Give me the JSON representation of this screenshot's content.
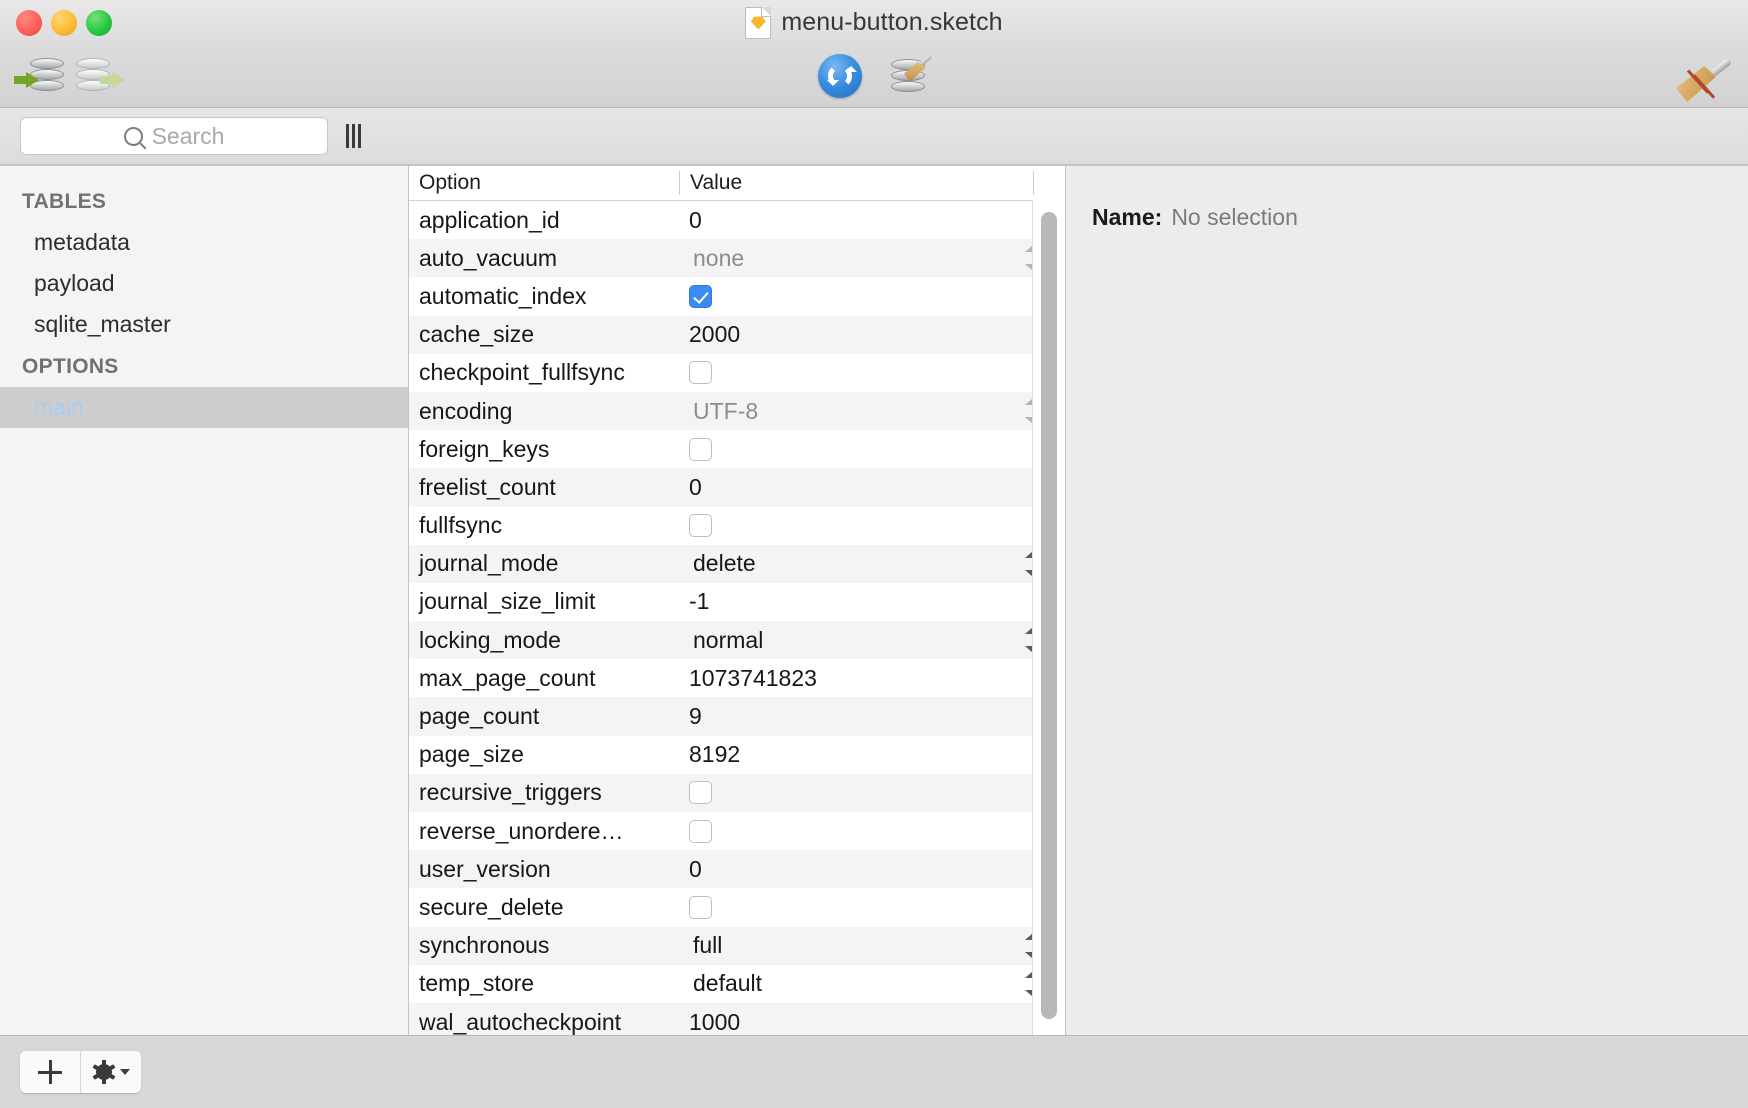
{
  "window": {
    "title": "menu-button.sketch",
    "doc_icon": "sketch-document-icon",
    "traffic_lights": [
      "close",
      "minimize",
      "zoom"
    ]
  },
  "toolbar": {
    "import_label": "import-database-icon",
    "export_label": "export-database-icon",
    "refresh_label": "refresh-icon",
    "vacuum_label": "vacuum-database-icon",
    "broom_label": "broom-icon"
  },
  "search": {
    "placeholder": "Search",
    "value": "",
    "icon": "search-icon",
    "grip": "sidebar-resize-grip"
  },
  "sidebar": {
    "sections": [
      {
        "header": "TABLES",
        "items": [
          {
            "label": "metadata",
            "selected": false
          },
          {
            "label": "payload",
            "selected": false
          },
          {
            "label": "sqlite_master",
            "selected": false
          }
        ]
      },
      {
        "header": "OPTIONS",
        "items": [
          {
            "label": "main",
            "selected": true
          }
        ]
      }
    ],
    "selection_bg": "#cdcdcd",
    "selection_fg": "#a9cdf0"
  },
  "table": {
    "columns": [
      "Option",
      "Value"
    ],
    "rows": [
      {
        "option": "application_id",
        "kind": "text",
        "value": "0"
      },
      {
        "option": "auto_vacuum",
        "kind": "popup",
        "value": "none",
        "dim": true
      },
      {
        "option": "automatic_index",
        "kind": "checkbox",
        "value": true
      },
      {
        "option": "cache_size",
        "kind": "text",
        "value": "2000"
      },
      {
        "option": "checkpoint_fullfsync",
        "kind": "checkbox",
        "value": false
      },
      {
        "option": "encoding",
        "kind": "popup",
        "value": "UTF-8",
        "dim": true
      },
      {
        "option": "foreign_keys",
        "kind": "checkbox",
        "value": false
      },
      {
        "option": "freelist_count",
        "kind": "text",
        "value": "0"
      },
      {
        "option": "fullfsync",
        "kind": "checkbox",
        "value": false
      },
      {
        "option": "journal_mode",
        "kind": "popup",
        "value": "delete",
        "dim": false
      },
      {
        "option": "journal_size_limit",
        "kind": "text",
        "value": "-1"
      },
      {
        "option": "locking_mode",
        "kind": "popup",
        "value": "normal",
        "dim": false
      },
      {
        "option": "max_page_count",
        "kind": "text",
        "value": "1073741823"
      },
      {
        "option": "page_count",
        "kind": "text",
        "value": "9"
      },
      {
        "option": "page_size",
        "kind": "text",
        "value": "8192"
      },
      {
        "option": "recursive_triggers",
        "kind": "checkbox",
        "value": false
      },
      {
        "option": "reverse_unordere…",
        "kind": "checkbox",
        "value": false
      },
      {
        "option": "user_version",
        "kind": "text",
        "value": "0"
      },
      {
        "option": "secure_delete",
        "kind": "checkbox",
        "value": false
      },
      {
        "option": "synchronous",
        "kind": "popup",
        "value": "full",
        "dim": false
      },
      {
        "option": "temp_store",
        "kind": "popup",
        "value": "default",
        "dim": false
      },
      {
        "option": "wal_autocheckpoint",
        "kind": "text",
        "value": "1000"
      }
    ],
    "checkbox_accent": "#3b8bf5"
  },
  "inspector": {
    "name_label": "Name:",
    "name_value": "No selection"
  },
  "bottombar": {
    "add_label": "plus-icon",
    "gear_label": "gear-icon",
    "caret_label": "chevron-down-icon"
  }
}
